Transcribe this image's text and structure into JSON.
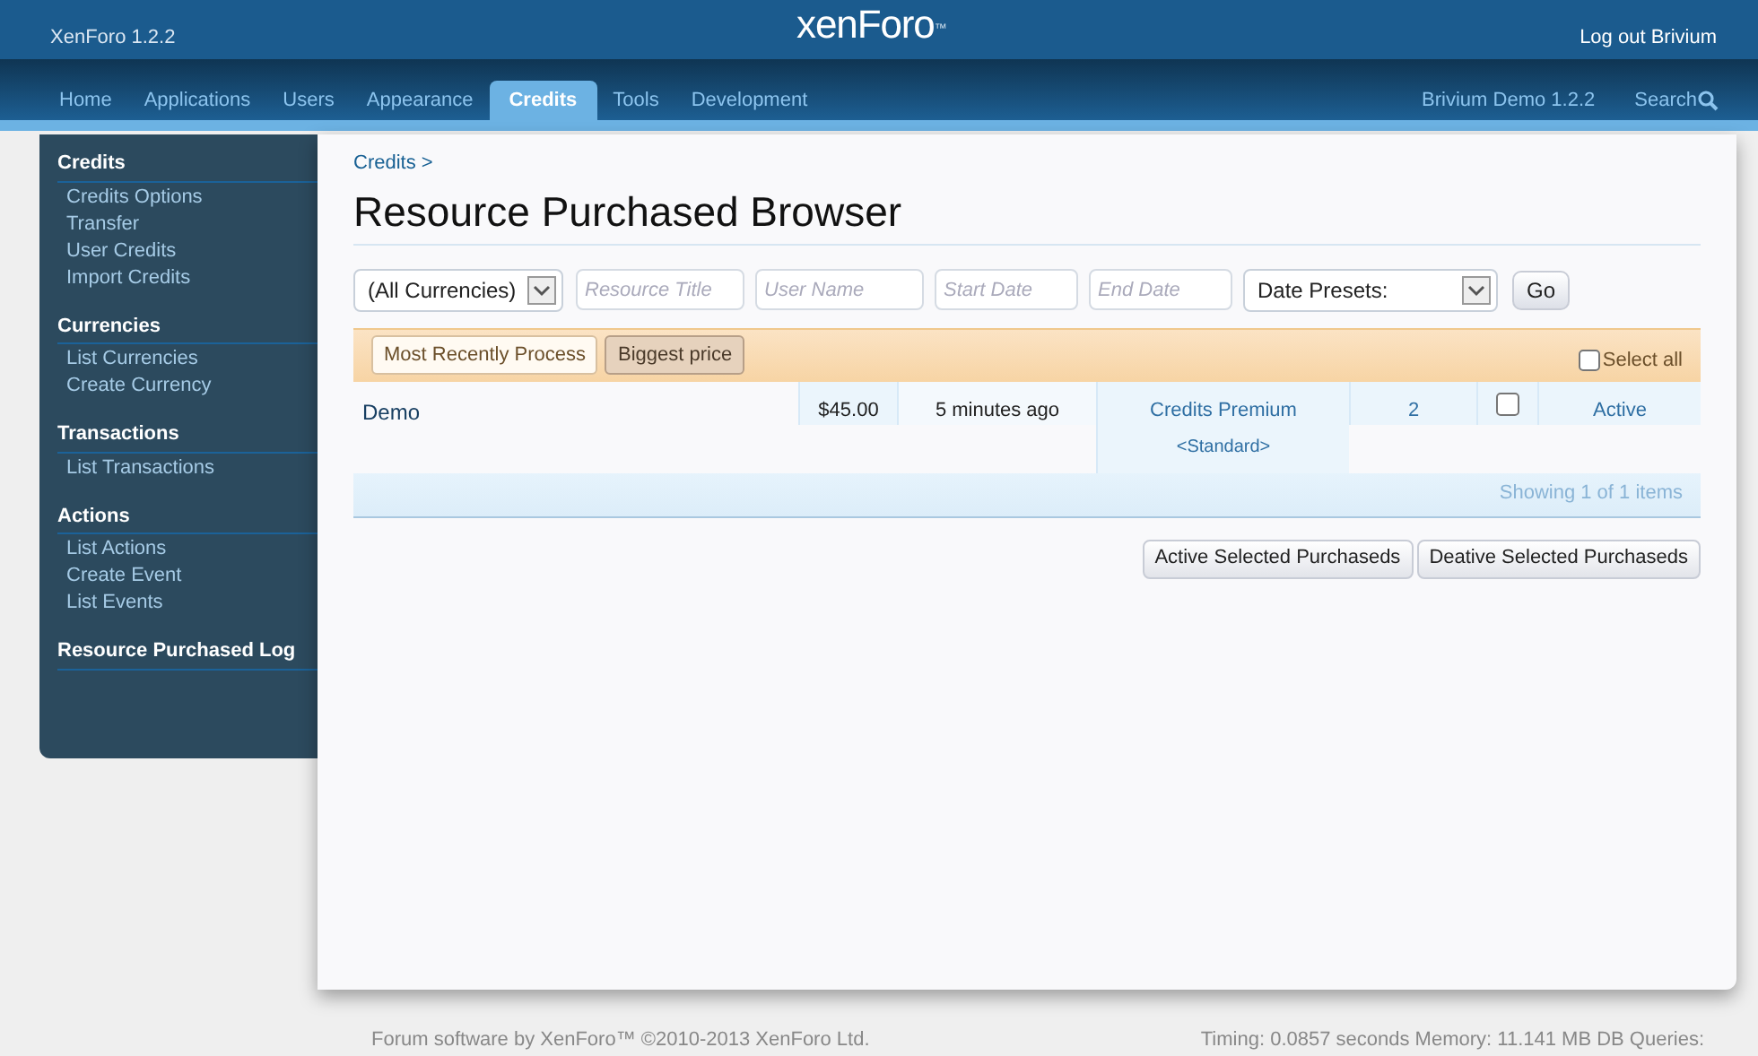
{
  "header": {
    "version": "XenForo 1.2.2",
    "logo": "xenForo",
    "logo_mark": "™",
    "logout": "Log out Brivium"
  },
  "tabs": [
    {
      "label": "Home",
      "selected": false
    },
    {
      "label": "Applications",
      "selected": false
    },
    {
      "label": "Users",
      "selected": false
    },
    {
      "label": "Appearance",
      "selected": false
    },
    {
      "label": "Credits",
      "selected": true
    },
    {
      "label": "Tools",
      "selected": false
    },
    {
      "label": "Development",
      "selected": false
    }
  ],
  "nav_right": {
    "site": "Brivium Demo 1.2.2",
    "search": "Search"
  },
  "sidebar": [
    {
      "heading": "Credits",
      "items": [
        "Credits Options",
        "Transfer",
        "User Credits",
        "Import Credits"
      ]
    },
    {
      "heading": "Currencies",
      "items": [
        "List Currencies",
        "Create Currency"
      ]
    },
    {
      "heading": "Transactions",
      "items": [
        "List Transactions"
      ]
    },
    {
      "heading": "Actions",
      "items": [
        "List Actions",
        "Create Event",
        "List Events"
      ]
    },
    {
      "heading": "Resource Purchased Log"
    }
  ],
  "breadcrumb": "Credits >",
  "title": "Resource Purchased Browser",
  "filters": {
    "currency": "(All Currencies)",
    "resource_title_placeholder": "Resource Title",
    "user_name_placeholder": "User Name",
    "start_date_placeholder": "Start Date",
    "end_date_placeholder": "End Date",
    "date_presets": "Date Presets:",
    "go": "Go"
  },
  "sort_buttons": [
    {
      "label": "Most Recently Process",
      "selected": false
    },
    {
      "label": "Biggest price",
      "selected": true
    }
  ],
  "select_all": {
    "label": "Select all",
    "checked": false
  },
  "rows": [
    {
      "resource": "Demo",
      "price": "$45.00",
      "time": "5 minutes ago",
      "package": "Credits Premium",
      "package_sub": "<Standard>",
      "count": "2",
      "checked": false,
      "status": "Active"
    }
  ],
  "showing": "Showing 1 of 1 items",
  "actions": [
    "Active Selected Purchaseds",
    "Deative Selected Purchaseds"
  ],
  "footer": {
    "copyright": "Forum software by XenForo™ ©2010-2013 XenForo Ltd.",
    "timing": "Timing: 0.0857 seconds Memory: 11.141 MB DB Queries:"
  }
}
